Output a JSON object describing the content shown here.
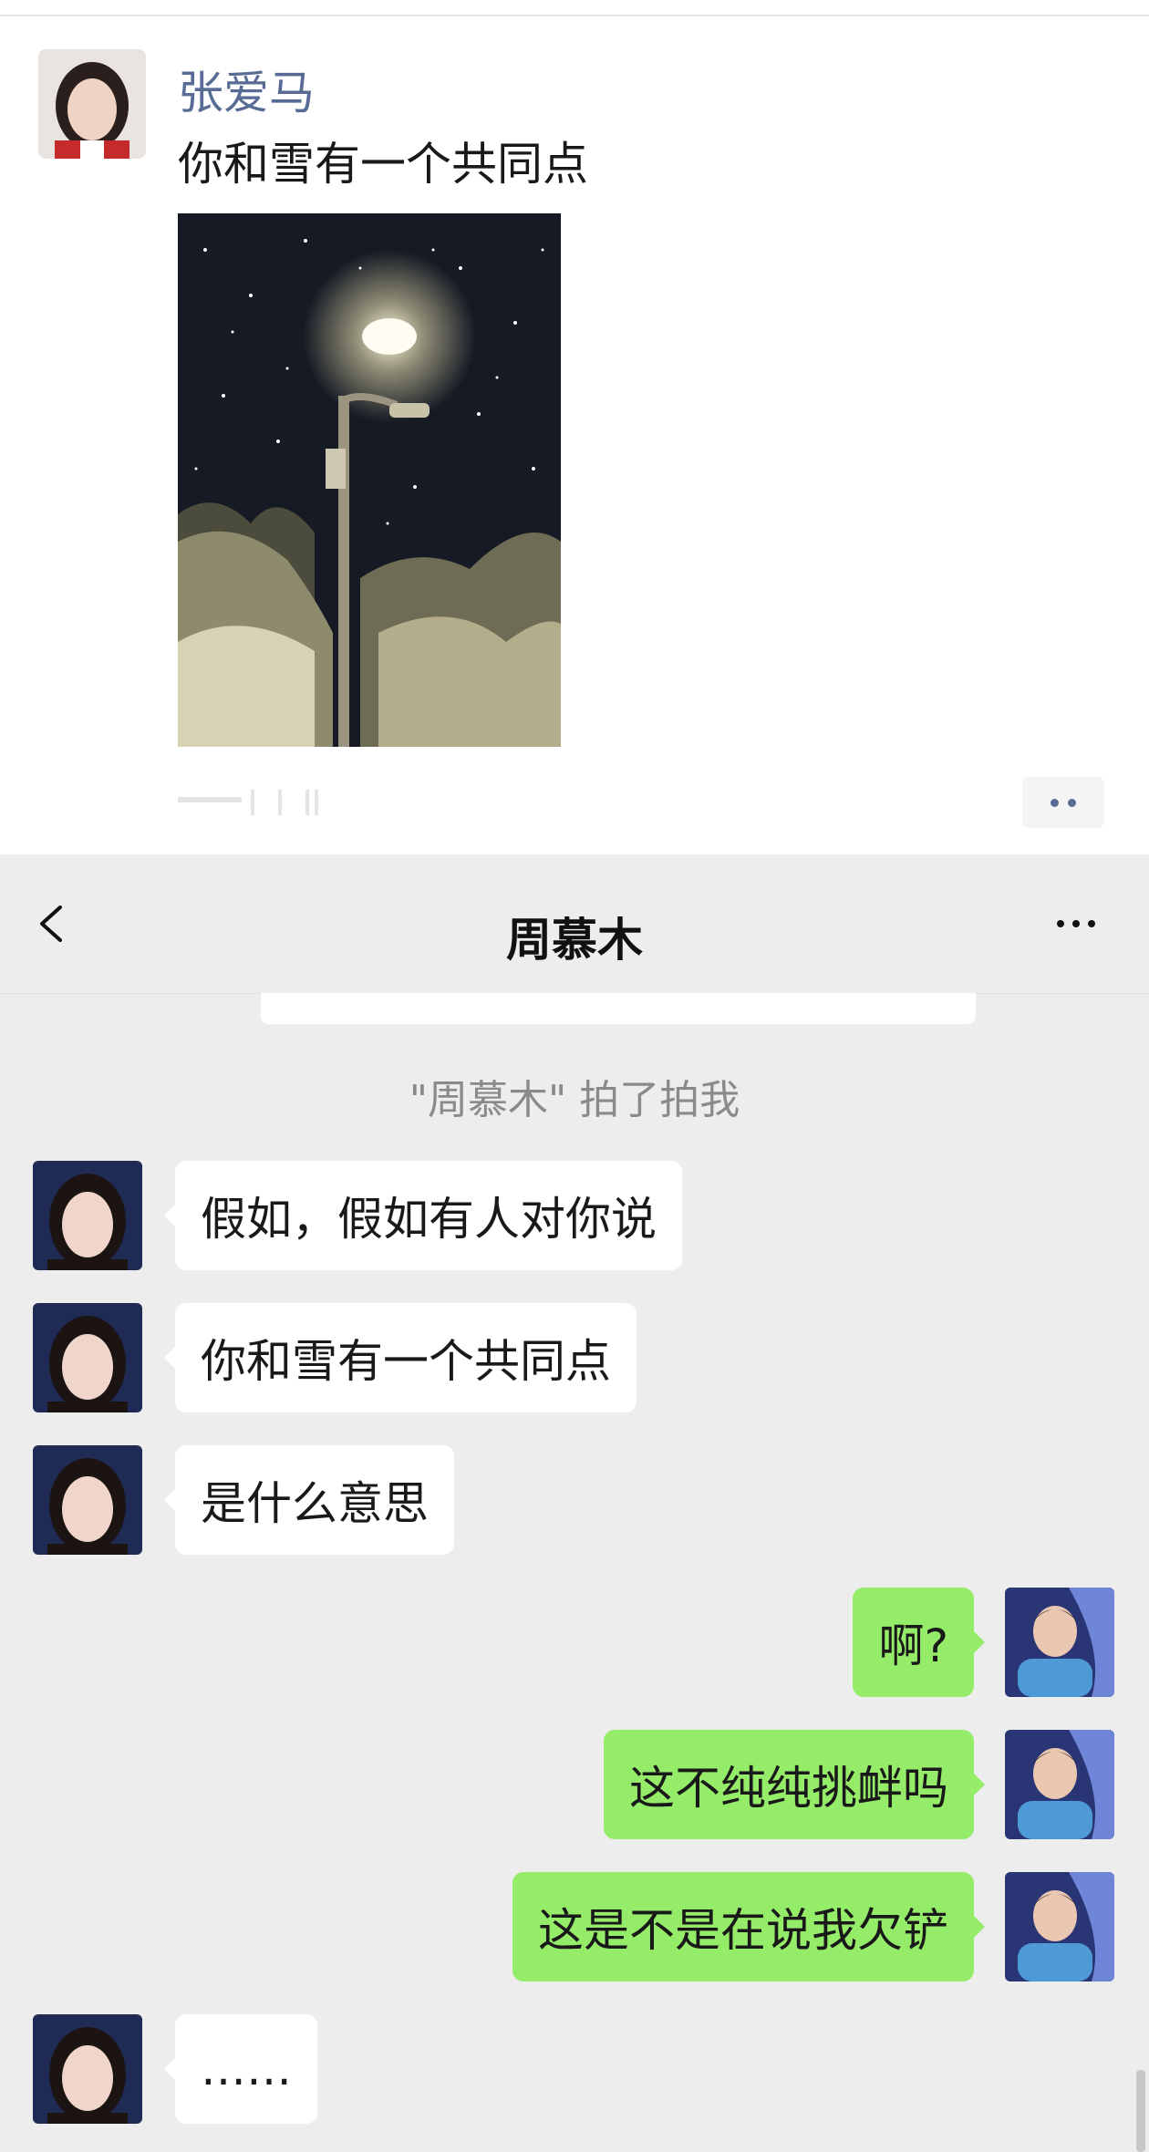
{
  "moment": {
    "author": "张爱马",
    "text": "你和雪有一个共同点",
    "photo_icon": "snowy-night-street-lamp-photo"
  },
  "chat": {
    "title": "周慕木",
    "back_icon": "chevron-left-icon",
    "more_icon": "more-dots-icon",
    "system_message": "\"周慕木\" 拍了拍我",
    "messages": [
      {
        "side": "left",
        "text": "假如，假如有人对你说"
      },
      {
        "side": "left",
        "text": "你和雪有一个共同点"
      },
      {
        "side": "left",
        "text": "是什么意思"
      },
      {
        "side": "right",
        "text": "啊?"
      },
      {
        "side": "right",
        "text": "这不纯纯挑衅吗"
      },
      {
        "side": "right",
        "text": "这是不是在说我欠铲"
      },
      {
        "side": "left",
        "text": "……"
      }
    ]
  },
  "colors": {
    "link_blue": "#576b95",
    "bubble_green": "#95ec69",
    "chat_bg": "#ededed"
  }
}
